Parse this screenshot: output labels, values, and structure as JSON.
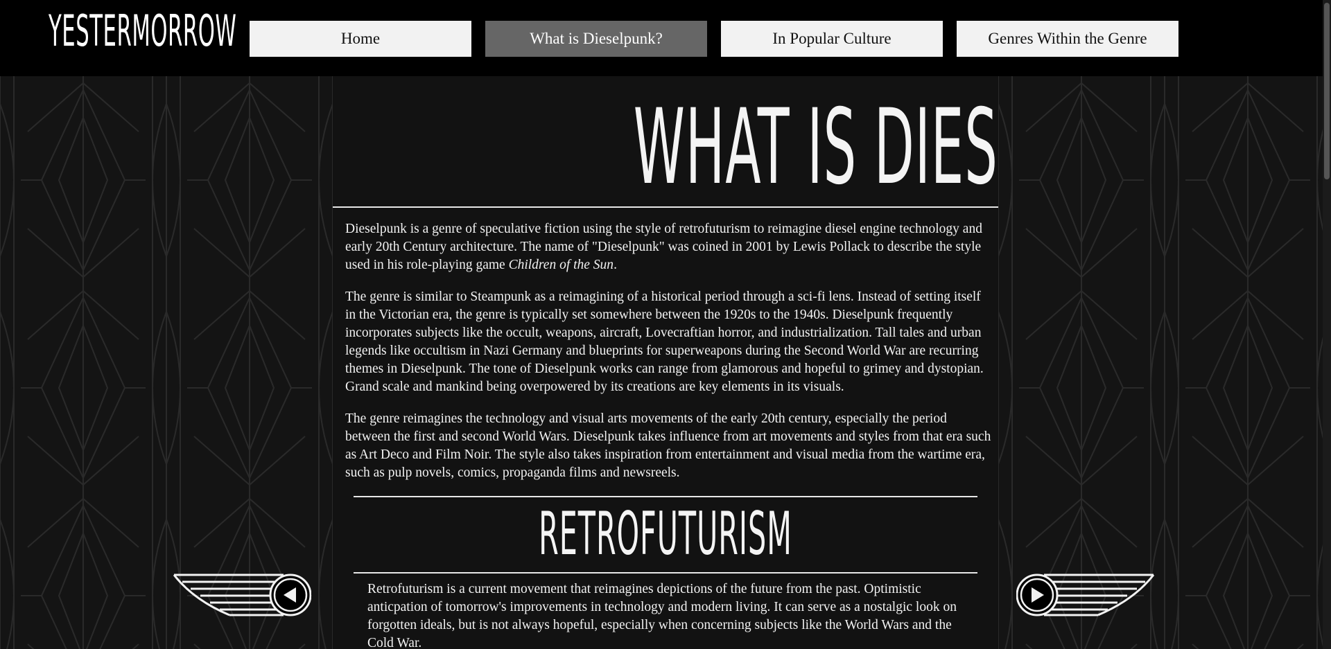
{
  "header": {
    "logo": "Yestermorrow",
    "nav": [
      {
        "label": "Home"
      },
      {
        "label": "What is Dieselpunk?"
      },
      {
        "label": "In Popular Culture"
      },
      {
        "label": "Genres Within the Genre"
      }
    ],
    "active_index": 1
  },
  "main": {
    "title": "What is Dieselpunk?",
    "p1_before": "Dieselpunk is a genre of speculative fiction using the style of retrofuturism to reimagine diesel engine technology and early 20th Century architecture. The name of \"Dieselpunk\" was coined in 2001 by Lewis Pollack to describe the style used in his role-playing game ",
    "p1_italic": "Children of the Sun",
    "p1_after": ".",
    "p2": "The genre is similar to Steampunk as a reimagining of a historical period through a sci-fi lens. Instead of setting itself in the Victorian era, the genre is typically set somewhere between the 1920s to the 1940s. Dieselpunk frequently incorporates subjects like the occult, weapons, aircraft, Lovecraftian horror, and industrialization. Tall tales and urban legends like occultism in Nazi Germany and blueprints for superweapons during the Second World War are recurring themes in Dieselpunk. The tone of Dieselpunk works can range from glamorous and hopeful to grimey and dystopian. Grand scale and mankind being overpowered by its creations are key elements in its visuals.",
    "p3": "The genre reimagines the technology and visual arts movements of the early 20th century, especially the period between the first and second World Wars. Dieselpunk takes influence from art movements and styles from that era such as Art Deco and Film Noir. The style also takes inspiration from entertainment and visual media from the wartime era, such as pulp novels, comics, propaganda films and newsreels.",
    "section": {
      "title": "Retrofuturism",
      "text": "Retrofuturism is a current movement that reimagines depictions of the future from the past. Optimistic anticpation of tomorrow's improvements in technology and modern living. It can serve as a nostalgic look on forgotten ideals, but is not always hopeful, especially when concerning subjects like the World Wars and the Cold War."
    }
  },
  "controls": {
    "prev_icon": "winged-left-arrow-icon",
    "next_icon": "winged-right-arrow-icon"
  },
  "colors": {
    "header_bg": "#000000",
    "page_bg": "#141414",
    "nav_bg": "#f2f2f2",
    "nav_active_bg": "#666666",
    "text": "#f2f2f2"
  }
}
